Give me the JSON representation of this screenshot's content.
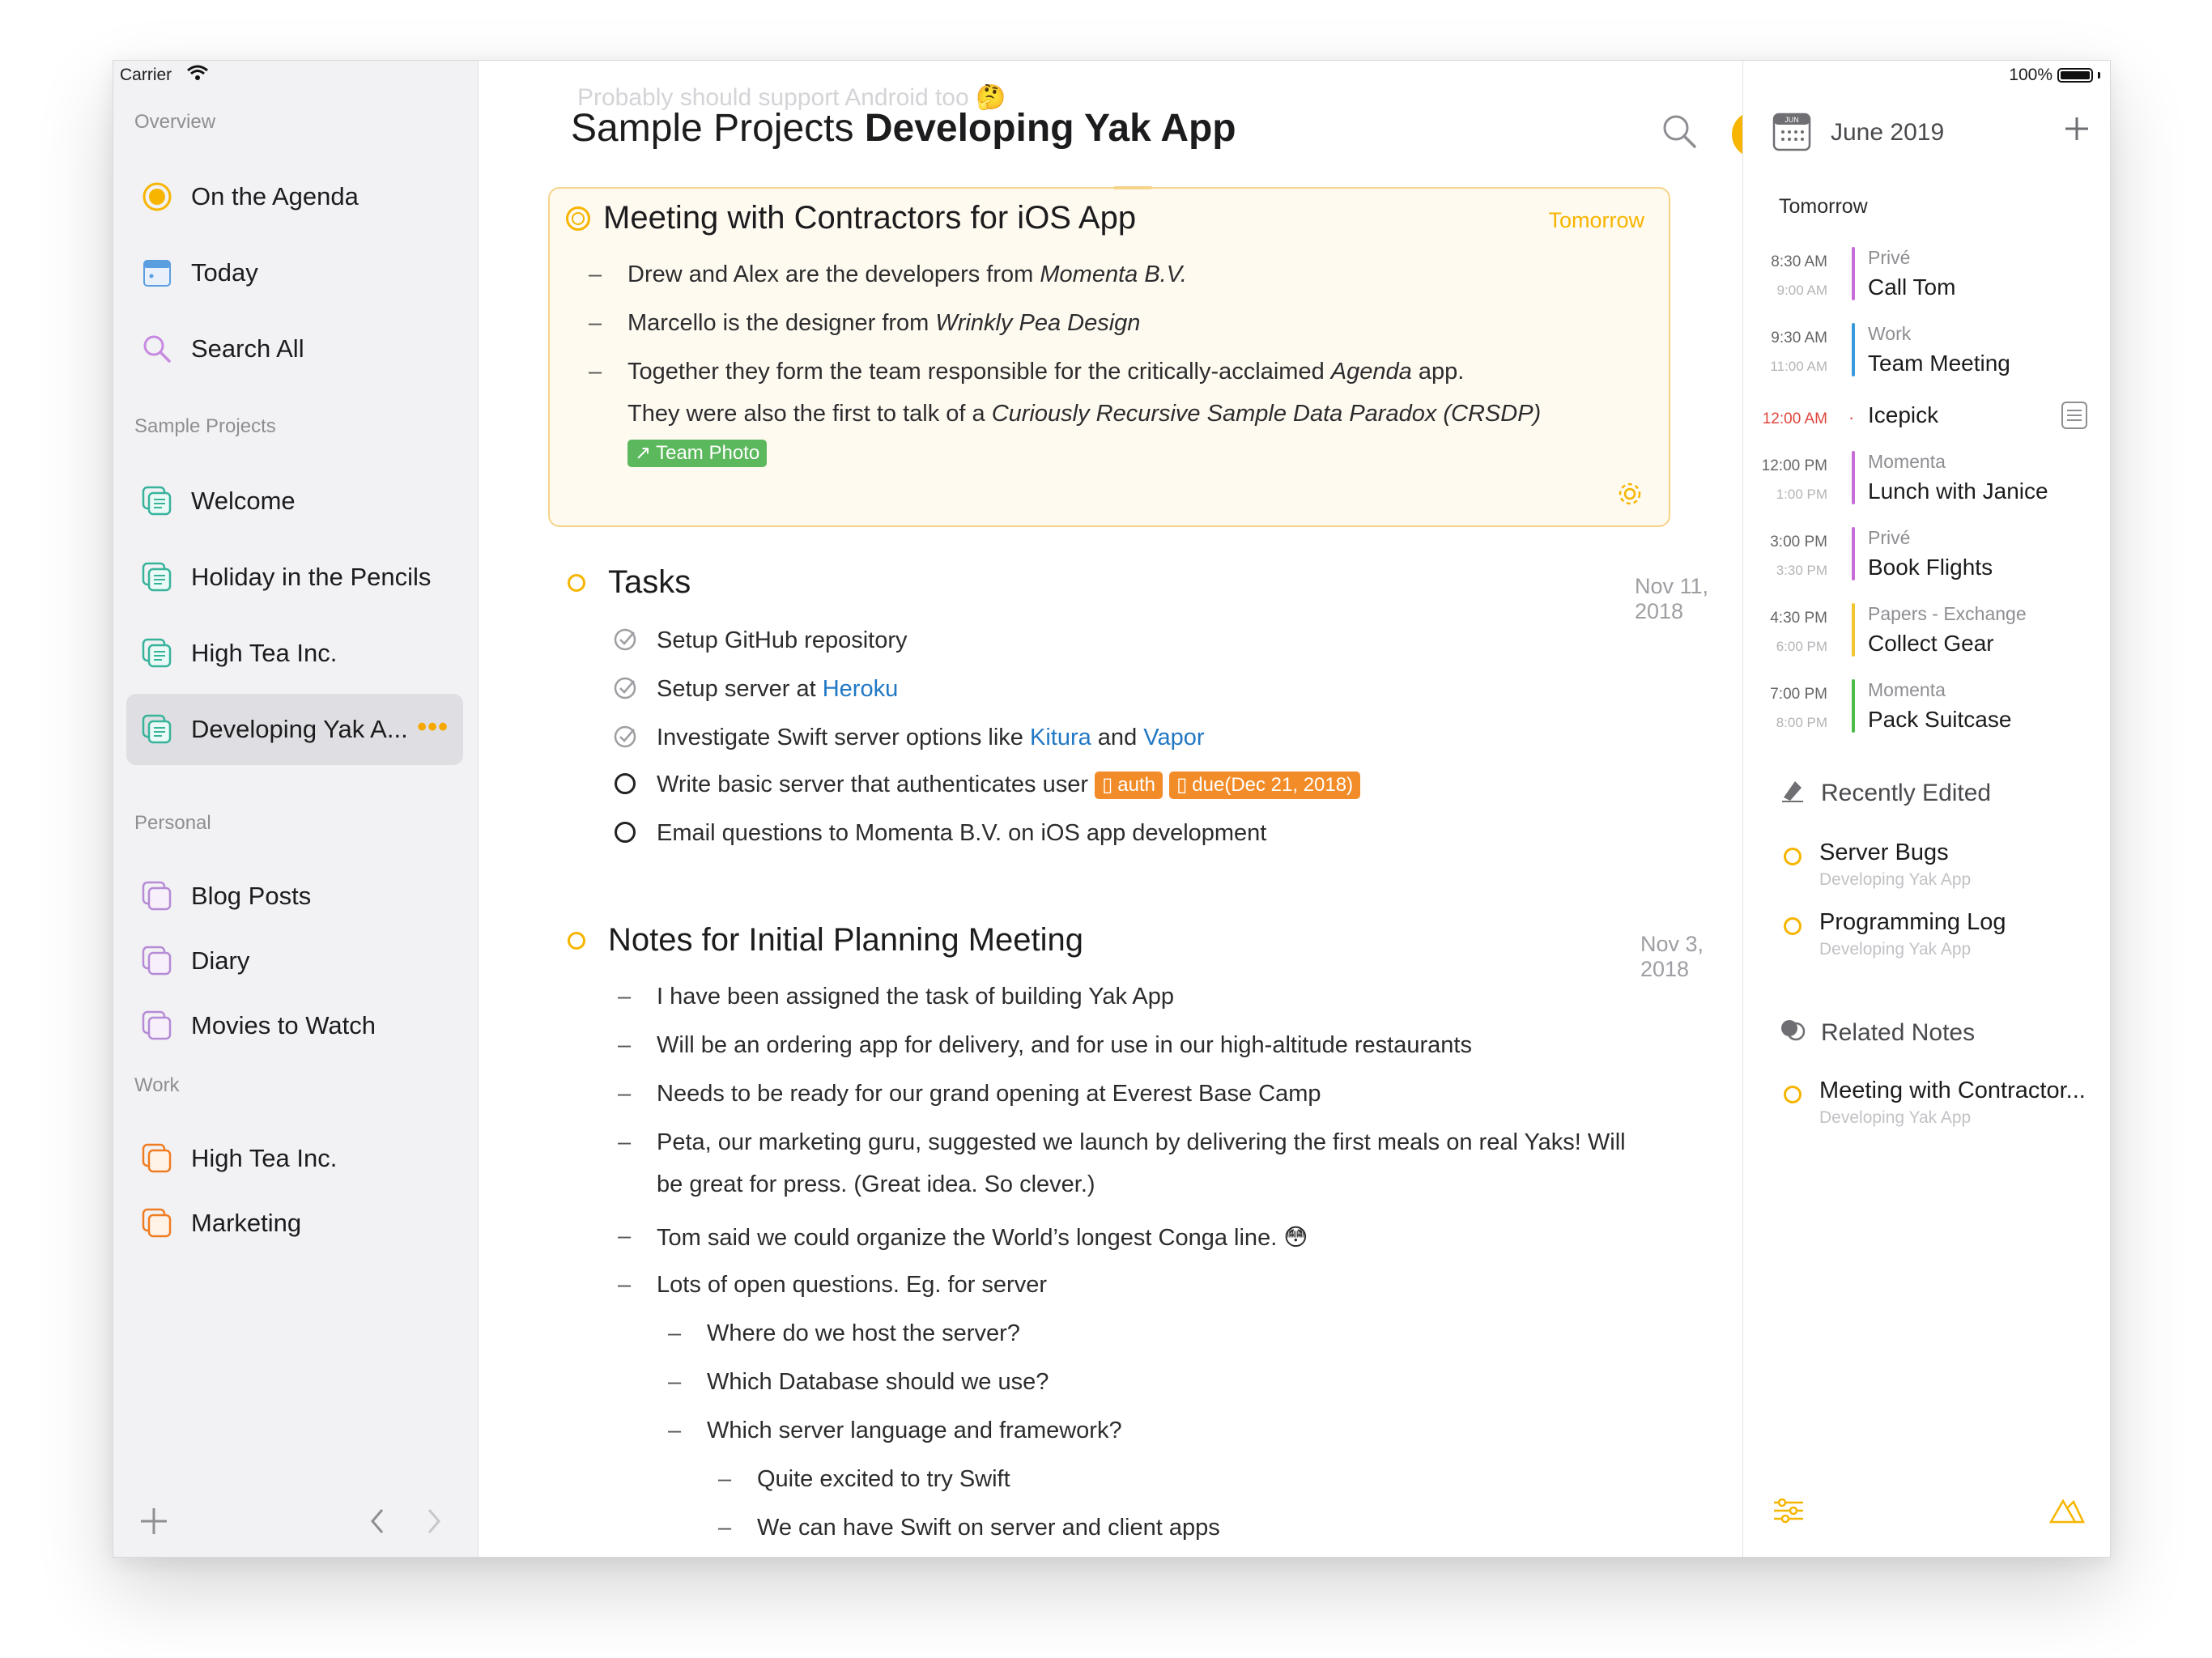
{
  "status": {
    "carrier": "Carrier",
    "battery": "100%"
  },
  "sidebar": {
    "overview_title": "Overview",
    "overview": [
      {
        "label": "On the Agenda",
        "icon": "agenda-icon"
      },
      {
        "label": "Today",
        "icon": "calendar-icon"
      },
      {
        "label": "Search All",
        "icon": "search-icon"
      }
    ],
    "sample_title": "Sample Projects",
    "sample": [
      {
        "label": "Welcome"
      },
      {
        "label": "Holiday in the Pencils"
      },
      {
        "label": "High Tea Inc."
      },
      {
        "label": "Developing Yak A...",
        "more": "•••"
      }
    ],
    "personal_title": "Personal",
    "personal": [
      {
        "label": "Blog Posts"
      },
      {
        "label": "Diary"
      },
      {
        "label": "Movies to Watch"
      }
    ],
    "work_title": "Work",
    "work": [
      {
        "label": "High Tea Inc."
      },
      {
        "label": "Marketing"
      }
    ]
  },
  "colors": {
    "accent": "#f7b500",
    "sample_icon": "#37b39a",
    "personal_icon": "#b58ad6",
    "work_icon": "#f07c22"
  },
  "main": {
    "ghost_text": "Probably should support Android too 🤔",
    "title_project": "Sample Projects",
    "title_name": "Developing Yak App",
    "card": {
      "title": "Meeting with Contractors for iOS App",
      "date": "Tomorrow",
      "lines": [
        {
          "pre": "Drew and Alex are the developers from ",
          "em": "Momenta B.V.",
          "post": ""
        },
        {
          "pre": "Marcello is the designer from ",
          "em": "Wrinkly Pea Design",
          "post": ""
        },
        {
          "pre": "Together they form the team responsible for the critically-acclaimed ",
          "em": "Agenda",
          "post": " app."
        },
        {
          "pre": "They were also the first to talk of a ",
          "em": "Curiously Recursive Sample Data Paradox (CRSDP)",
          "post": ""
        }
      ],
      "tag": "Team Photo"
    },
    "tasks": {
      "title": "Tasks",
      "date": "Nov 11, 2018",
      "items": [
        {
          "pre": "Setup GitHub repository"
        },
        {
          "pre": "Setup server at ",
          "link1": "Heroku"
        },
        {
          "pre": "Investigate Swift server options like ",
          "link1": "Kitura",
          "mid": " and ",
          "link2": "Vapor"
        },
        {
          "pre": "Write basic server that authenticates user",
          "tag1": "auth",
          "tag2": "due(Dec 21, 2018)"
        },
        {
          "pre": "Email questions to Momenta B.V. on iOS app development"
        }
      ]
    },
    "planning": {
      "title": "Notes for Initial Planning Meeting",
      "date": "Nov 3, 2018",
      "lines": [
        "I have been assigned the task of building Yak App",
        "Will be an ordering app for delivery, and for use in our high-altitude restaurants",
        "Needs to be ready for our grand opening at Everest Base Camp",
        "Peta, our marketing guru, suggested we launch by delivering the first meals on real Yaks! Will",
        "be great for press. (Great idea. So clever.)",
        "Tom said we could organize the World’s longest Conga line. 😳",
        "Lots of open questions. Eg. for server",
        "Where do we host the server?",
        "Which Database should we use?",
        "Which server language and framework?",
        "Quite excited to try Swift",
        "We can have Swift on server and client apps"
      ]
    }
  },
  "right": {
    "month": "June 2019",
    "cal_badge": "JUN",
    "day_label": "Tomorrow",
    "events": [
      {
        "start": "8:30 AM",
        "end": "9:00 AM",
        "calendar": "Privé",
        "title": "Call Tom",
        "color": "#c86dd7"
      },
      {
        "start": "9:30 AM",
        "end": "11:00 AM",
        "calendar": "Work",
        "title": "Team Meeting",
        "color": "#3a9bdc"
      },
      {
        "start": "12:00 AM",
        "end": "",
        "calendar": "",
        "title": "Icepick",
        "color": "#e0463c"
      },
      {
        "start": "12:00 PM",
        "end": "1:00 PM",
        "calendar": "Momenta",
        "title": "Lunch with Janice",
        "color": "#c86dd7"
      },
      {
        "start": "3:00 PM",
        "end": "3:30 PM",
        "calendar": "Privé",
        "title": "Book Flights",
        "color": "#c86dd7"
      },
      {
        "start": "4:30 PM",
        "end": "6:00 PM",
        "calendar": "Papers - Exchange",
        "title": "Collect Gear",
        "color": "#f2c530"
      },
      {
        "start": "7:00 PM",
        "end": "8:00 PM",
        "calendar": "Momenta",
        "title": "Pack Suitcase",
        "color": "#4cbb4a"
      }
    ],
    "recent_title": "Recently Edited",
    "recent": [
      {
        "title": "Server Bugs",
        "sub": "Developing Yak App"
      },
      {
        "title": "Programming Log",
        "sub": "Developing Yak App"
      }
    ],
    "related_title": "Related Notes",
    "related": [
      {
        "title": "Meeting with Contractor...",
        "sub": "Developing Yak App"
      }
    ]
  }
}
